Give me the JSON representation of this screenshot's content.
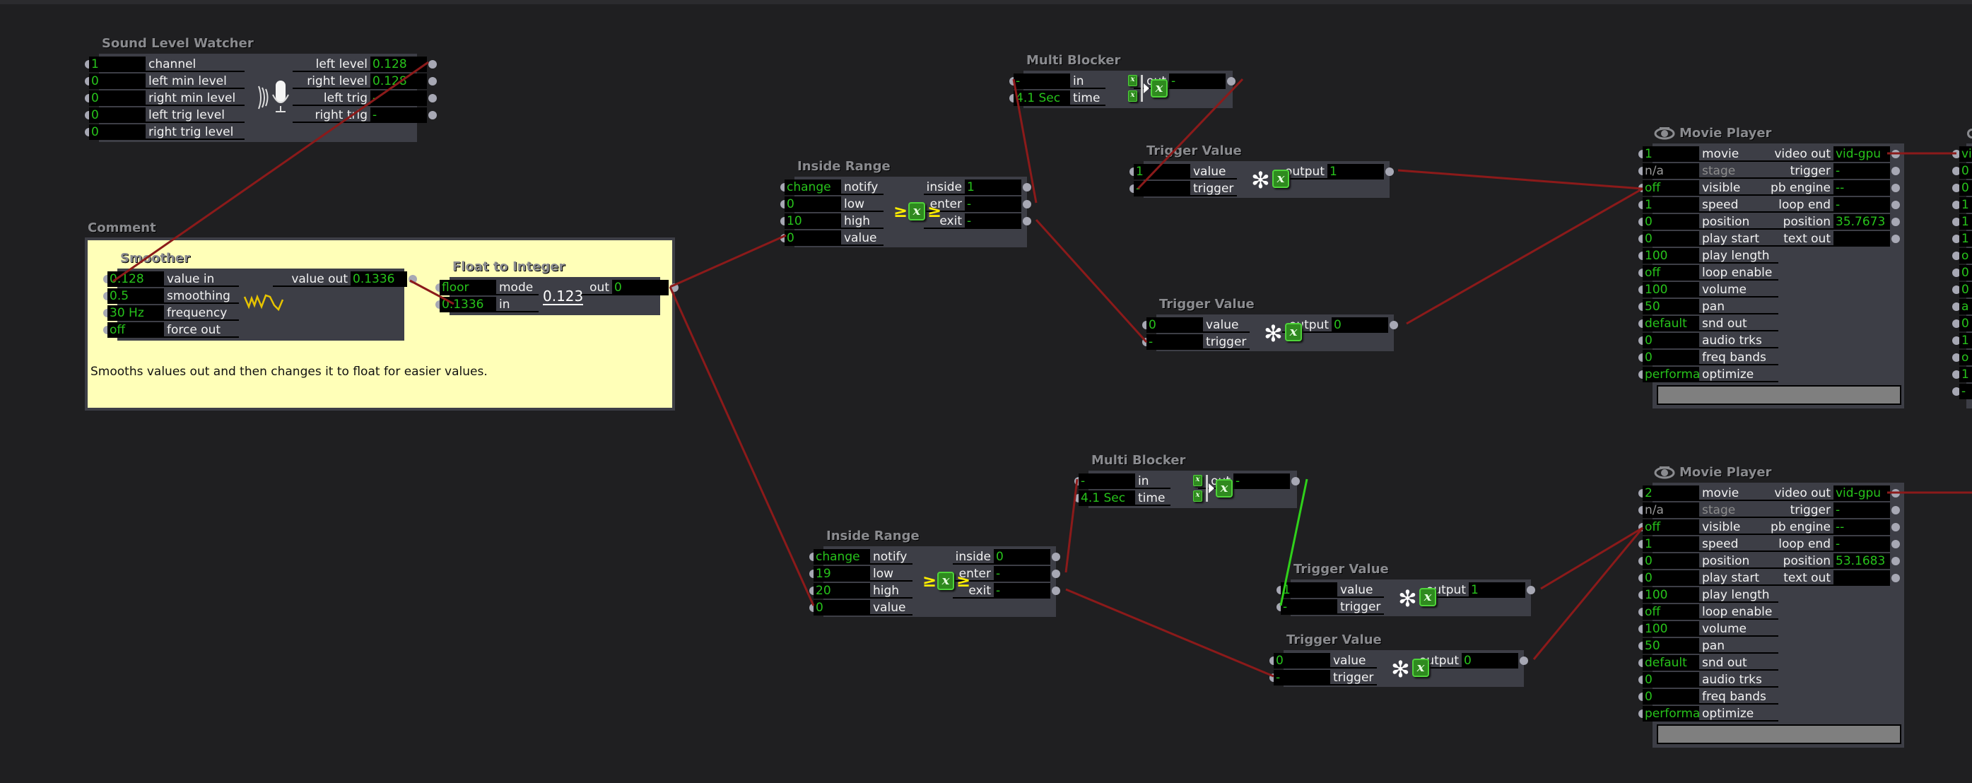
{
  "canvas": {
    "wire_color": "#8b1a1a",
    "active_wire_color": "#2fd11a",
    "value_color": "#27c21b",
    "panel_color": "#3d3e46",
    "background": "#1f1f21",
    "comment_color": "#ffffb8"
  },
  "sound_level_watcher": {
    "title": "Sound Level Watcher",
    "inputs": [
      {
        "value": "1",
        "label": "channel"
      },
      {
        "value": "0",
        "label": "left min level"
      },
      {
        "value": "0",
        "label": "right min level"
      },
      {
        "value": "0",
        "label": "left trig level"
      },
      {
        "value": "0",
        "label": "right trig level"
      }
    ],
    "outputs": [
      {
        "label": "left level",
        "value": "0.128"
      },
      {
        "label": "right level",
        "value": "0.128"
      },
      {
        "label": "left trig",
        "value": "-"
      },
      {
        "label": "right trig",
        "value": "-"
      }
    ],
    "icon": "microphone-icon"
  },
  "comment": {
    "title": "Comment",
    "text": "Smooths values out and then changes it to float for easier values."
  },
  "smoother": {
    "title": "Smoother",
    "inputs": [
      {
        "value": "0.128",
        "label": "value in"
      },
      {
        "value": "0.5",
        "label": "smoothing"
      },
      {
        "value": "30 Hz",
        "label": "frequency"
      },
      {
        "value": "off",
        "label": "force out"
      }
    ],
    "outputs": [
      {
        "label": "value out",
        "value": "0.1336"
      }
    ],
    "icon": "waveform-icon"
  },
  "float_to_integer": {
    "title": "Float to Integer",
    "inputs": [
      {
        "value": "floor",
        "label": "mode"
      },
      {
        "value": "0.1336",
        "label": "in"
      }
    ],
    "outputs": [
      {
        "label": "out",
        "value": "0"
      }
    ],
    "icon_text": "0.123"
  },
  "multi_blocker_1": {
    "title": "Multi Blocker",
    "inputs": [
      {
        "value": "-",
        "label": "in"
      },
      {
        "value": "4.1 Sec",
        "label": "time"
      }
    ],
    "outputs": [
      {
        "label": "out",
        "value": "-"
      }
    ]
  },
  "inside_range_1": {
    "title": "Inside Range",
    "inputs": [
      {
        "value": "change",
        "label": "notify"
      },
      {
        "value": "0",
        "label": "low"
      },
      {
        "value": "10",
        "label": "high"
      },
      {
        "value": "0",
        "label": "value"
      }
    ],
    "outputs": [
      {
        "label": "inside",
        "value": "1"
      },
      {
        "label": "enter",
        "value": "-"
      },
      {
        "label": "exit",
        "value": "-"
      }
    ]
  },
  "trigger_value_1": {
    "title": "Trigger Value",
    "inputs": [
      {
        "value": "1",
        "label": "value"
      },
      {
        "value": "-",
        "label": "trigger"
      }
    ],
    "outputs": [
      {
        "label": "output",
        "value": "1"
      }
    ]
  },
  "trigger_value_2": {
    "title": "Trigger Value",
    "inputs": [
      {
        "value": "0",
        "label": "value"
      },
      {
        "value": "-",
        "label": "trigger"
      }
    ],
    "outputs": [
      {
        "label": "output",
        "value": "0"
      }
    ]
  },
  "movie_player_1": {
    "title": "Movie Player",
    "inputs": [
      {
        "value": "1",
        "label": "movie"
      },
      {
        "value": "n/a",
        "label": "stage",
        "dim": true
      },
      {
        "value": "off",
        "label": "visible"
      },
      {
        "value": "1",
        "label": "speed"
      },
      {
        "value": "0",
        "label": "position"
      },
      {
        "value": "0",
        "label": "play start"
      },
      {
        "value": "100",
        "label": "play length"
      },
      {
        "value": "off",
        "label": "loop enable"
      },
      {
        "value": "100",
        "label": "volume"
      },
      {
        "value": "50",
        "label": "pan"
      },
      {
        "value": "default",
        "label": "snd out"
      },
      {
        "value": "0",
        "label": "audio trks"
      },
      {
        "value": "0",
        "label": "freq bands"
      },
      {
        "value": "performa",
        "label": "optimize"
      }
    ],
    "outputs": [
      {
        "label": "video out",
        "value": "vid-gpu"
      },
      {
        "label": "trigger",
        "value": "-"
      },
      {
        "label": "pb engine",
        "value": "--"
      },
      {
        "label": "loop end",
        "value": "-"
      },
      {
        "label": "position",
        "value": "35.7673"
      },
      {
        "label": "text out",
        "value": ""
      }
    ]
  },
  "inside_range_2": {
    "title": "Inside Range",
    "inputs": [
      {
        "value": "change",
        "label": "notify"
      },
      {
        "value": "19",
        "label": "low"
      },
      {
        "value": "20",
        "label": "high"
      },
      {
        "value": "0",
        "label": "value"
      }
    ],
    "outputs": [
      {
        "label": "inside",
        "value": "0"
      },
      {
        "label": "enter",
        "value": "-"
      },
      {
        "label": "exit",
        "value": "-"
      }
    ]
  },
  "multi_blocker_2": {
    "title": "Multi Blocker",
    "inputs": [
      {
        "value": "-",
        "label": "in"
      },
      {
        "value": "4.1 Sec",
        "label": "time"
      }
    ],
    "outputs": [
      {
        "label": "out",
        "value": "-"
      }
    ]
  },
  "trigger_value_3": {
    "title": "Trigger Value",
    "inputs": [
      {
        "value": "1",
        "label": "value"
      },
      {
        "value": "-",
        "label": "trigger"
      }
    ],
    "outputs": [
      {
        "label": "output",
        "value": "1"
      }
    ]
  },
  "trigger_value_4": {
    "title": "Trigger Value",
    "inputs": [
      {
        "value": "0",
        "label": "value"
      },
      {
        "value": "-",
        "label": "trigger"
      }
    ],
    "outputs": [
      {
        "label": "output",
        "value": "0"
      }
    ]
  },
  "movie_player_2": {
    "title": "Movie Player",
    "inputs": [
      {
        "value": "2",
        "label": "movie"
      },
      {
        "value": "n/a",
        "label": "stage",
        "dim": true
      },
      {
        "value": "off",
        "label": "visible"
      },
      {
        "value": "1",
        "label": "speed"
      },
      {
        "value": "0",
        "label": "position"
      },
      {
        "value": "0",
        "label": "play start"
      },
      {
        "value": "100",
        "label": "play length"
      },
      {
        "value": "off",
        "label": "loop enable"
      },
      {
        "value": "100",
        "label": "volume"
      },
      {
        "value": "50",
        "label": "pan"
      },
      {
        "value": "default",
        "label": "snd out"
      },
      {
        "value": "0",
        "label": "audio trks"
      },
      {
        "value": "0",
        "label": "freq bands"
      },
      {
        "value": "performa",
        "label": "optimize"
      }
    ],
    "outputs": [
      {
        "label": "video out",
        "value": "vid-gpu"
      },
      {
        "label": "trigger",
        "value": "-"
      },
      {
        "label": "pb engine",
        "value": "--"
      },
      {
        "label": "loop end",
        "value": "-"
      },
      {
        "label": "position",
        "value": "53.1683"
      },
      {
        "label": "text out",
        "value": ""
      }
    ]
  },
  "offscreen_actor": {
    "inputs": [
      "vi",
      "0",
      "0",
      "1",
      "1",
      "1",
      "o",
      "0",
      "0",
      "a",
      "0",
      "1",
      "o",
      "1",
      "-"
    ]
  }
}
